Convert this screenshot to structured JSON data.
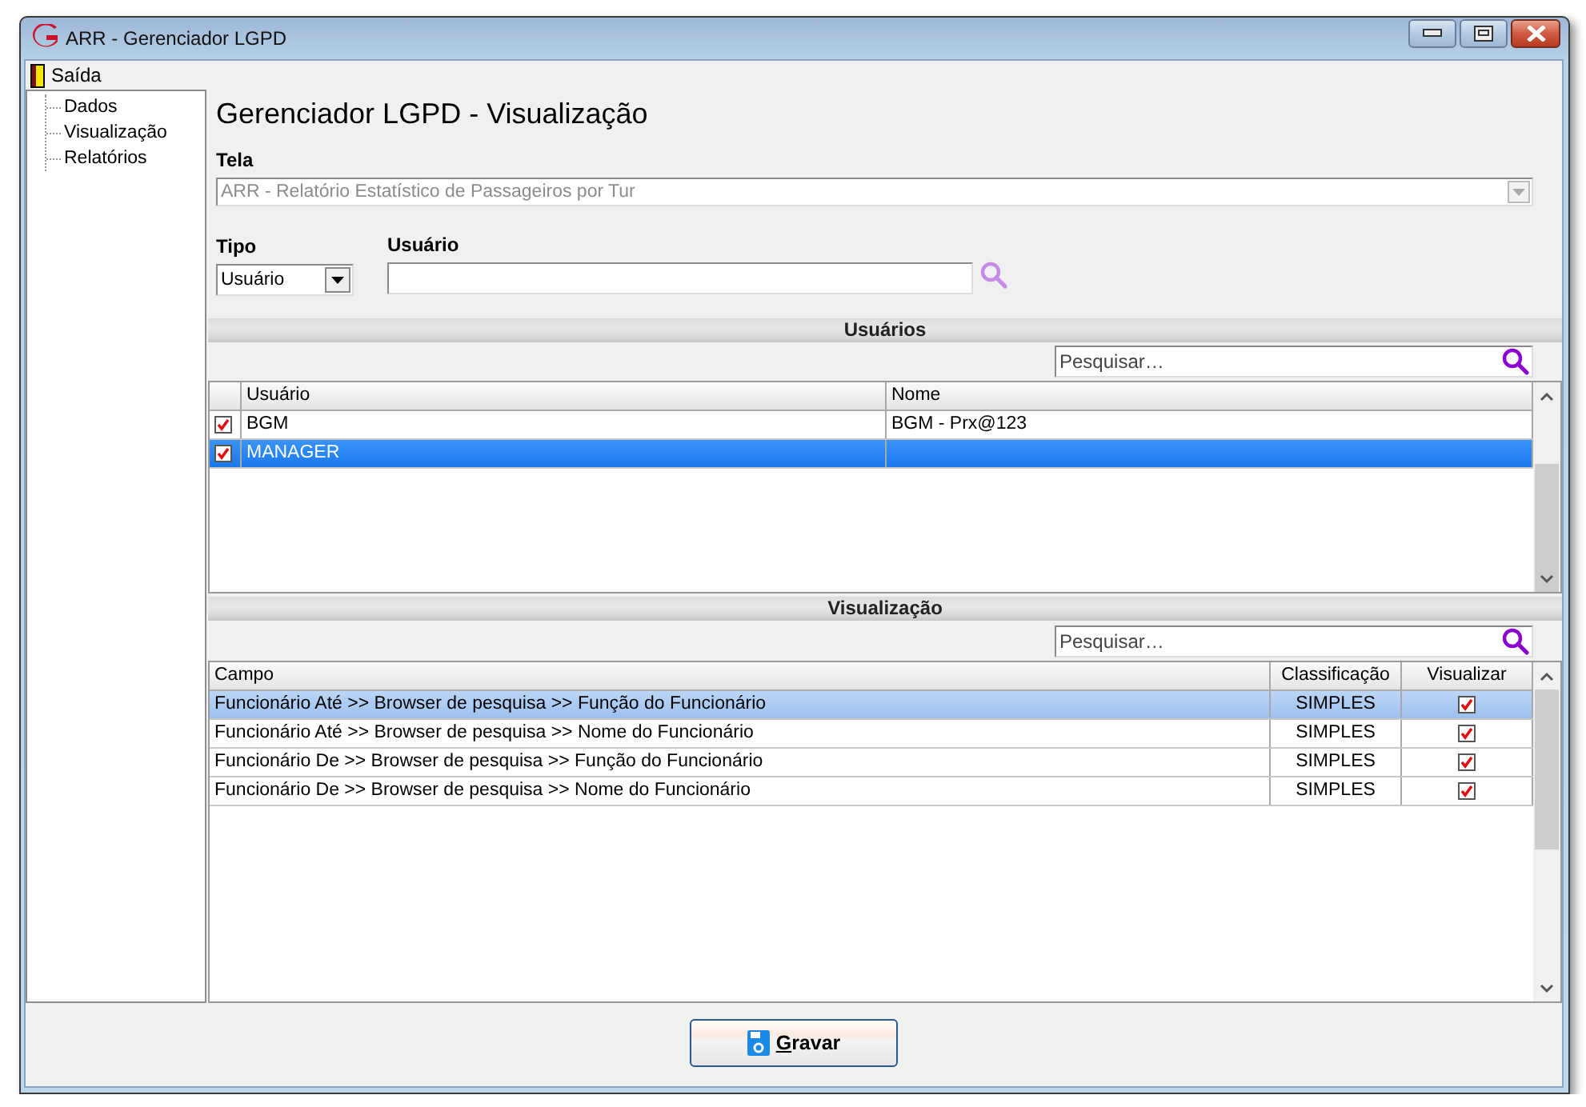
{
  "window": {
    "title": "ARR - Gerenciador LGPD"
  },
  "menu": [
    {
      "label": "Saída"
    }
  ],
  "sidebar": {
    "items": [
      {
        "label": "Dados"
      },
      {
        "label": "Visualização"
      },
      {
        "label": "Relatórios"
      }
    ]
  },
  "heading": "Gerenciador LGPD - Visualização",
  "tela": {
    "label": "Tela",
    "value": "ARR - Relatório Estatístico de Passageiros por Tur",
    "disabled": true
  },
  "tipo": {
    "label": "Tipo",
    "value": "Usuário"
  },
  "usuario": {
    "label": "Usuário"
  },
  "usuarios": {
    "title": "Usuários",
    "search": {
      "placeholder": "Pesquisar…"
    },
    "table": {
      "columns": [
        "Usuário",
        "Nome"
      ],
      "rows": [
        {
          "checked": true,
          "selected": false,
          "cells": [
            "BGM",
            "BGM - Prx@123"
          ]
        },
        {
          "checked": true,
          "selected": true,
          "cells": [
            "MANAGER"
          ]
        }
      ]
    }
  },
  "visualizacao": {
    "title": "Visualização",
    "search": {
      "placeholder": "Pesquisar…"
    },
    "table": {
      "columns": [
        "Campo",
        "Classificação",
        "Visualizar"
      ],
      "rows": [
        {
          "selected": true,
          "campo": "Funcionário Até >> Browser de pesquisa >> Função do Funcionário",
          "classificacao": "SIMPLES",
          "visualizar": true
        },
        {
          "selected": false,
          "campo": "Funcionário Até >> Browser de pesquisa >> Nome do Funcionário",
          "classificacao": "SIMPLES",
          "visualizar": true
        },
        {
          "selected": false,
          "campo": "Funcionário De >> Browser de pesquisa >> Função do Funcionário",
          "classificacao": "SIMPLES",
          "visualizar": true
        },
        {
          "selected": false,
          "campo": "Funcionário De >> Browser de pesquisa >> Nome do Funcionário",
          "classificacao": "SIMPLES",
          "visualizar": true
        }
      ]
    }
  },
  "buttons": [
    {
      "label": "Gravar"
    }
  ]
}
